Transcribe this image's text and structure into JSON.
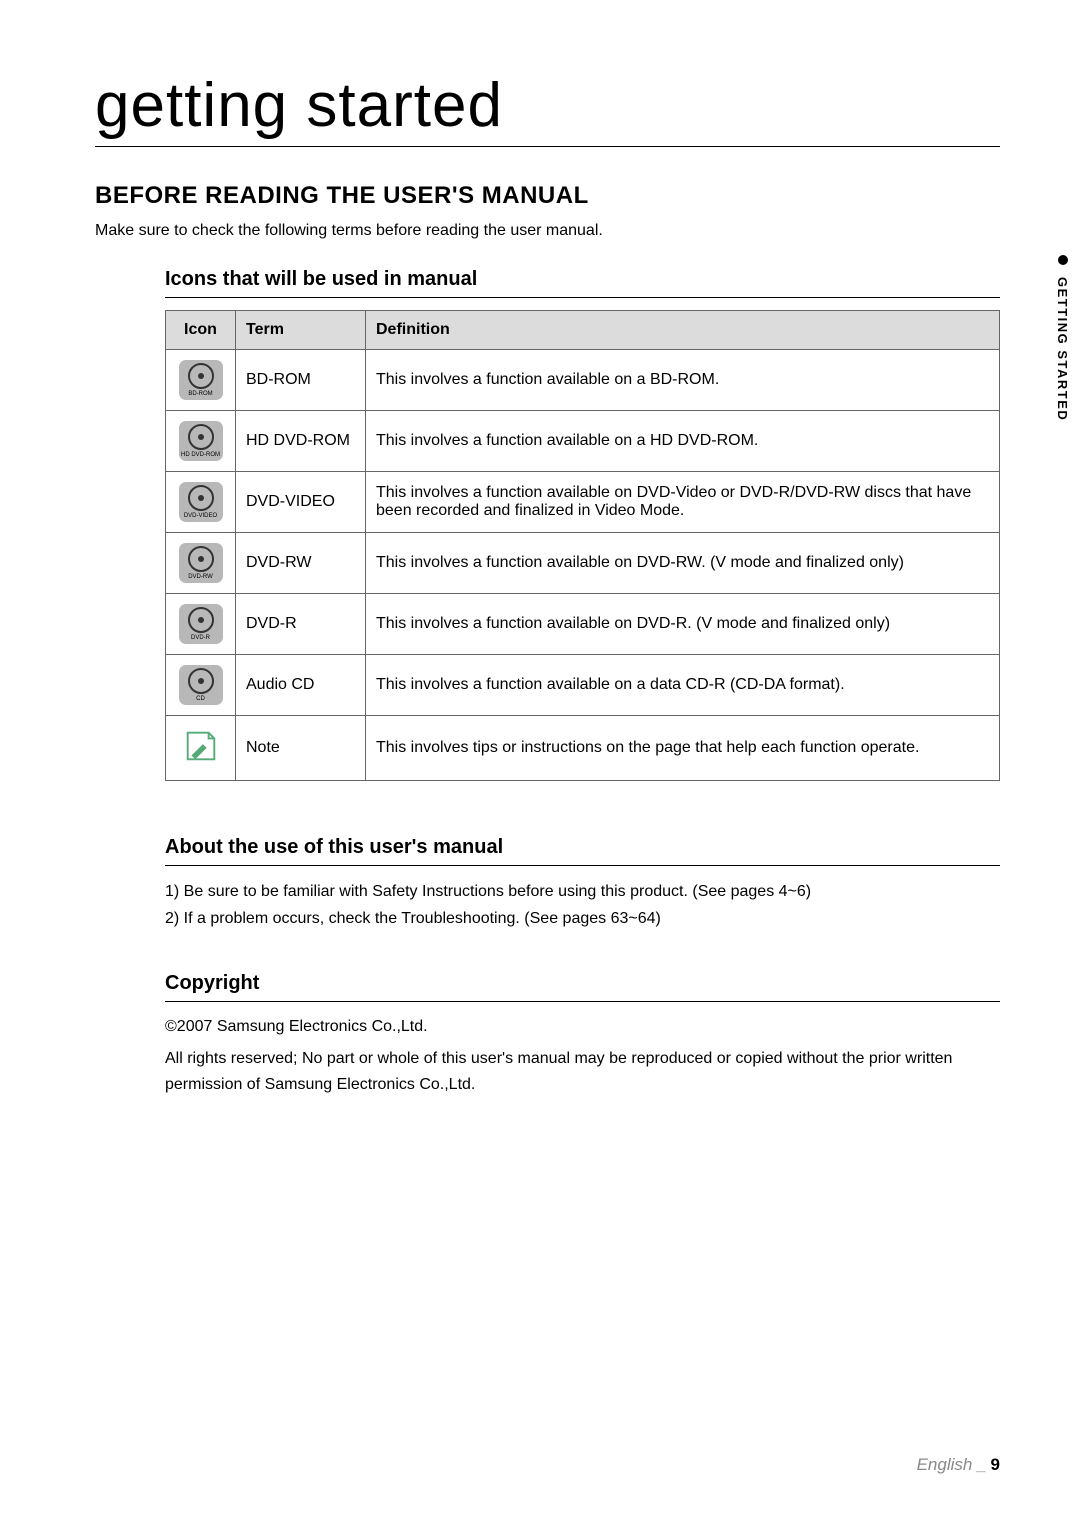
{
  "pageTitle": "getting started",
  "sectionTitle": "BEFORE READING THE USER'S MANUAL",
  "introText": "Make sure to check the following terms before reading the user manual.",
  "iconsSubtitle": "Icons that will be used in manual",
  "tableHeaders": {
    "icon": "Icon",
    "term": "Term",
    "definition": "Definition"
  },
  "iconRows": [
    {
      "iconLabel": "BD-ROM",
      "term": "BD-ROM",
      "definition": "This involves a function available on a BD-ROM."
    },
    {
      "iconLabel": "HD DVD-ROM",
      "term": "HD DVD-ROM",
      "definition": "This involves a function available on a HD DVD-ROM."
    },
    {
      "iconLabel": "DVD-VIDEO",
      "term": "DVD-VIDEO",
      "definition": "This involves a function available on DVD-Video or DVD-R/DVD-RW discs that have been recorded and finalized in Video Mode."
    },
    {
      "iconLabel": "DVD-RW",
      "term": "DVD-RW",
      "definition": "This involves a function available on DVD-RW. (V mode and finalized only)"
    },
    {
      "iconLabel": "DVD-R",
      "term": "DVD-R",
      "definition": "This involves a function available on DVD-R. (V mode and finalized only)"
    },
    {
      "iconLabel": "CD",
      "term": "Audio CD",
      "definition": "This involves a function available on a data CD-R (CD-DA format)."
    },
    {
      "iconLabel": "",
      "term": "Note",
      "definition": "This involves tips or instructions on the page that help each function operate."
    }
  ],
  "aboutSubtitle": "About the use of this user's manual",
  "aboutItems": [
    "1)  Be sure to be familiar with Safety Instructions before using this product. (See pages 4~6)",
    "2)  If a problem occurs, check the Troubleshooting. (See pages 63~64)"
  ],
  "copyrightSubtitle": "Copyright",
  "copyrightLines": [
    "©2007 Samsung Electronics Co.,Ltd.",
    "All rights reserved; No part or whole of this user's manual may be reproduced or copied without the prior written permission of Samsung Electronics Co.,Ltd."
  ],
  "sideTab": "GETTING STARTED",
  "footer": {
    "language": "English _",
    "pageNumber": "9"
  }
}
